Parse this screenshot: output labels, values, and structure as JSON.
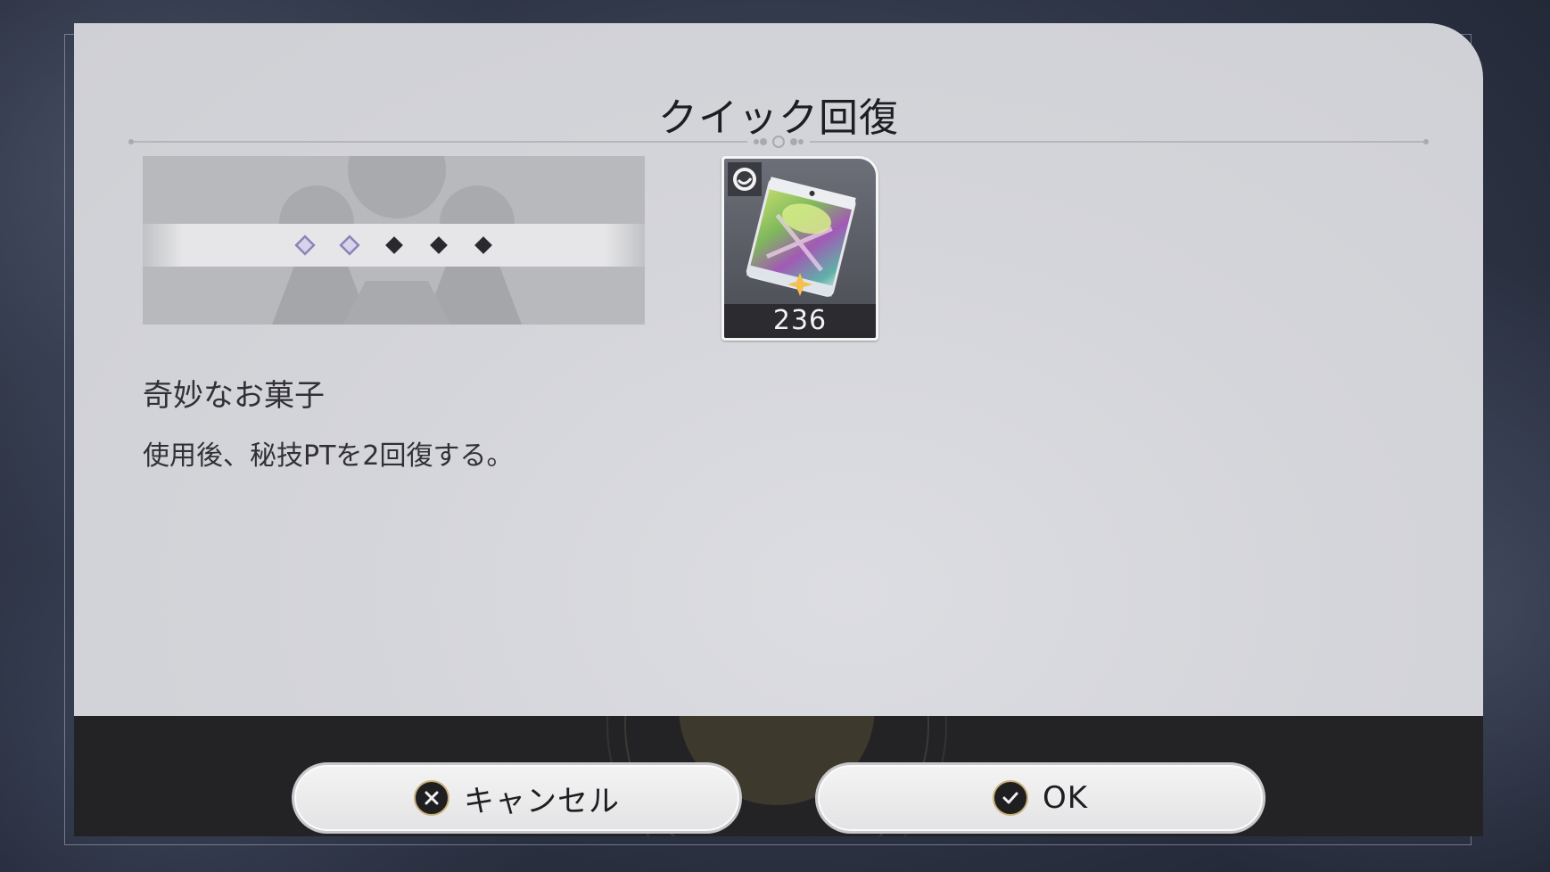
{
  "dialog": {
    "title": "クイック回復"
  },
  "item": {
    "name": "奇妙なお菓子",
    "description": "使用後、秘技PTを2回復する。",
    "count": "236",
    "icon": "snack-bag-icon",
    "rarity_icon": "rarity-badge-icon"
  },
  "technique_points": {
    "filled": 2,
    "total": 5
  },
  "buttons": {
    "cancel_label": "キャンセル",
    "ok_label": "OK"
  },
  "colors": {
    "footer": "#232325",
    "dialog_bg": "#d4d5da",
    "accent_gold": "#c9b27a",
    "point_filled": "#8a84b8"
  }
}
